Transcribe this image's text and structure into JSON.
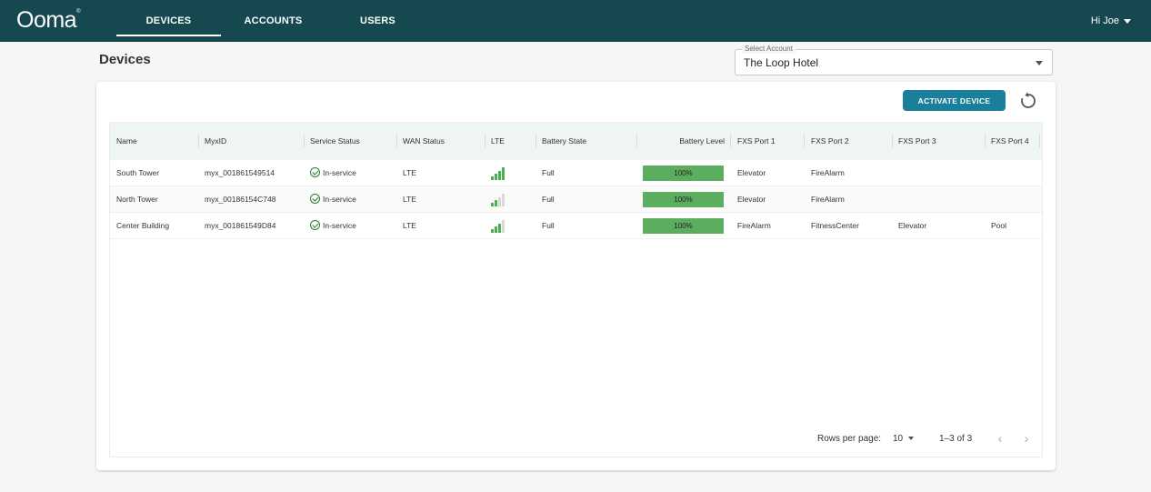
{
  "brand": {
    "name": "Ooma",
    "mark": "®"
  },
  "nav": {
    "tabs": [
      {
        "label": "DEVICES",
        "active": true
      },
      {
        "label": "ACCOUNTS",
        "active": false
      },
      {
        "label": "USERS",
        "active": false
      }
    ],
    "user_greeting": "Hi Joe"
  },
  "page": {
    "title": "Devices"
  },
  "account_select": {
    "legend": "Select Account",
    "value": "The Loop Hotel"
  },
  "toolbar": {
    "activate_label": "ACTIVATE DEVICE",
    "refresh_icon": "refresh-icon"
  },
  "table": {
    "columns": [
      "Name",
      "MyxID",
      "Service Status",
      "WAN Status",
      "LTE",
      "Battery State",
      "Battery Level",
      "FXS Port 1",
      "FXS Port 2",
      "FXS Port 3",
      "FXS Port 4"
    ],
    "rows": [
      {
        "name": "South Tower",
        "myxid": "myx_001861549514",
        "service": "In-service",
        "wan": "LTE",
        "lte_bars": 4,
        "battery_state": "Full",
        "battery_level": "100%",
        "battery_fraction": 1.0,
        "fxs1": "Elevator",
        "fxs2": "FireAlarm",
        "fxs3": "",
        "fxs4": ""
      },
      {
        "name": "North Tower",
        "myxid": "myx_00186154C748",
        "service": "In-service",
        "wan": "LTE",
        "lte_bars": 2,
        "battery_state": "Full",
        "battery_level": "100%",
        "battery_fraction": 1.0,
        "fxs1": "Elevator",
        "fxs2": "FireAlarm",
        "fxs3": "",
        "fxs4": ""
      },
      {
        "name": "Center Building",
        "myxid": "myx_001861549D84",
        "service": "In-service",
        "wan": "LTE",
        "lte_bars": 3,
        "battery_state": "Full",
        "battery_level": "100%",
        "battery_fraction": 1.0,
        "fxs1": "FireAlarm",
        "fxs2": "FitnessCenter",
        "fxs3": "Elevator",
        "fxs4": "Pool"
      }
    ]
  },
  "pagination": {
    "rows_label": "Rows per page:",
    "rows_value": "10",
    "range": "1–3 of 3",
    "prev_icon": "chevron-left-icon",
    "next_icon": "chevron-right-icon"
  },
  "colors": {
    "topbar": "#164850",
    "accent": "#1a7f9a",
    "battery": "#5bae5f",
    "signal_on": "#4caf50",
    "status_ok": "#2e7d32"
  }
}
